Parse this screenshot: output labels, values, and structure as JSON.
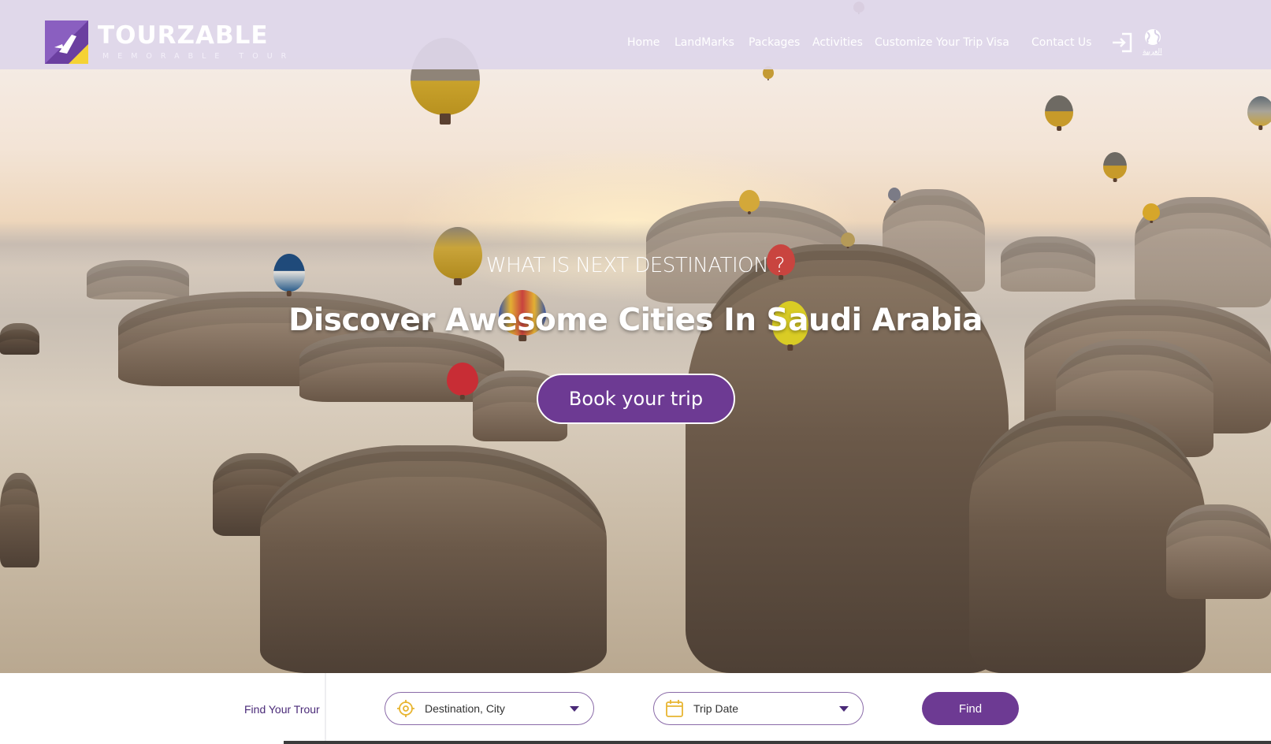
{
  "brand": {
    "name": "TOURZABLE",
    "tagline": "MEMORABLE TOUR"
  },
  "nav": {
    "items": [
      "Home",
      "LandMarks",
      "Packages",
      "Activities",
      "Customize Your Trip Visa",
      "Contact Us"
    ],
    "login_icon": "sign-in-icon",
    "language_icon": "globe-icon",
    "language_label": "العربية"
  },
  "hero": {
    "kicker": "WHAT IS NEXT DESTINATION ?",
    "headline": "Discover Awesome Cities In Saudi Arabia",
    "cta_label": "Book your trip"
  },
  "search": {
    "label": "Find Your Trour",
    "destination_value": "Destination, City",
    "destination_icon": "location-target-icon",
    "date_value": "Trip Date",
    "date_icon": "calendar-icon",
    "find_label": "Find"
  },
  "colors": {
    "primary": "#6d3a93",
    "header_bg": "#ded6ea",
    "logo_purple": "#6b3fa0",
    "logo_yellow": "#f5d235",
    "icon_gold": "#e8b531"
  }
}
